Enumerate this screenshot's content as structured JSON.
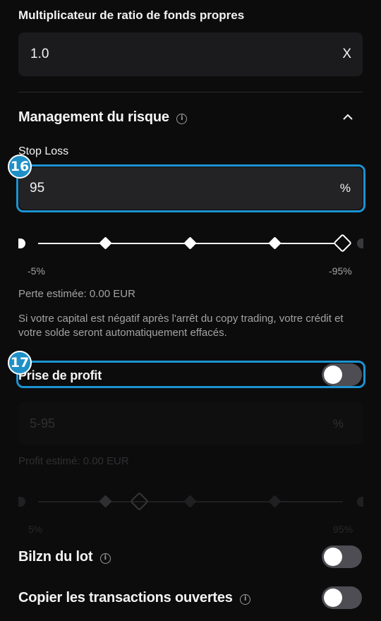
{
  "equity_multiplier": {
    "label": "Multiplicateur de ratio de fonds propres",
    "value": "1.0",
    "suffix": "X"
  },
  "risk_management": {
    "title": "Management du risque",
    "info_icon": "info-icon",
    "collapse_icon": "chevron-up-icon"
  },
  "stop_loss": {
    "label": "Stop Loss",
    "value": "95",
    "suffix": "%",
    "badge": "16",
    "slider": {
      "min_label": "-5%",
      "max_label": "-95%",
      "value_fraction": 1.0
    },
    "estimated_loss": "Perte estimée: 0.00 EUR",
    "note": "Si votre capital est négatif après l'arrêt du copy trading, votre crédit et votre solde seront automatiquement effacés."
  },
  "take_profit": {
    "label": "Prise de profit",
    "badge": "17",
    "enabled": false,
    "placeholder": "5-95",
    "suffix": "%",
    "estimated_profit": "Profit estimé: 0.00 EUR",
    "slider": {
      "min_label": "5%",
      "max_label": "95%",
      "value_fraction": 0.36
    }
  },
  "lot_balance": {
    "label": "Bilzn du lot",
    "enabled": false
  },
  "copy_open": {
    "label": "Copier les transactions ouvertes",
    "enabled": false
  },
  "colors": {
    "background": "#0c0c0d",
    "field": "#1b1b1d",
    "accent": "#1c93d1",
    "toggle_off": "#4d4d53"
  }
}
